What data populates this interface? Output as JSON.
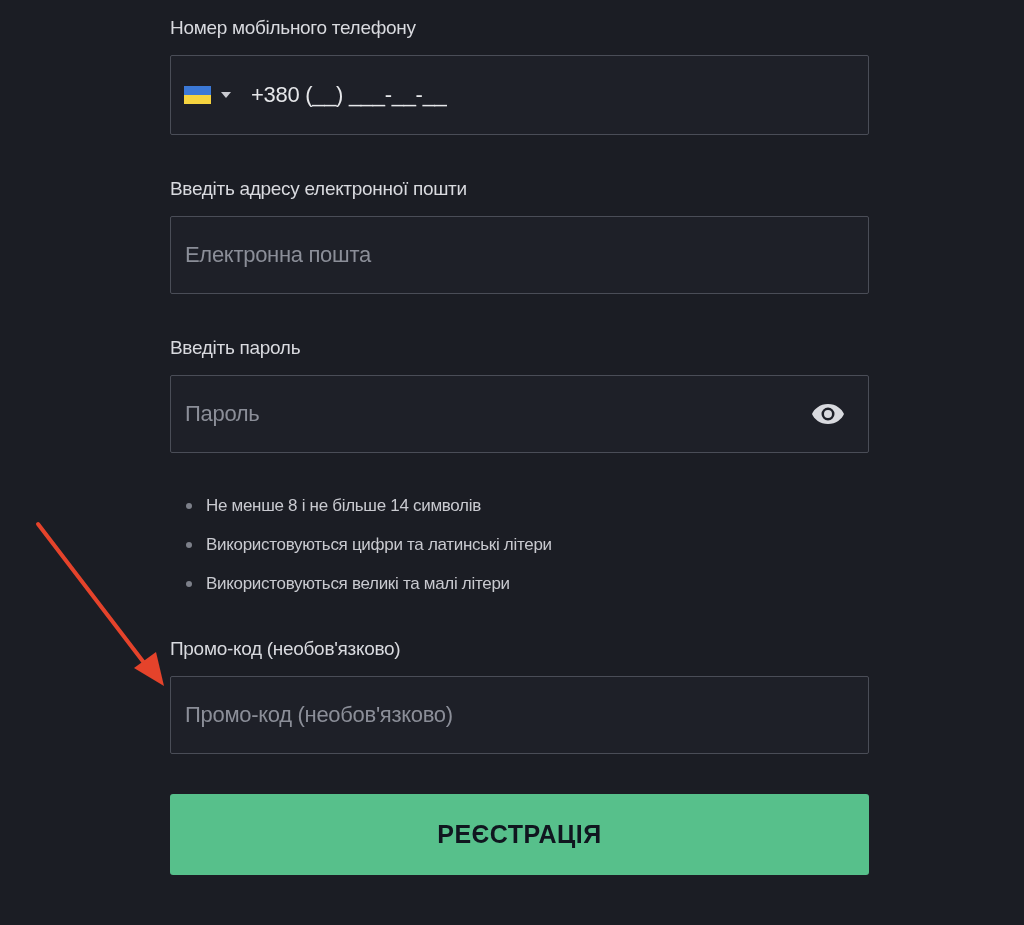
{
  "fields": [
    {
      "kind": "phone",
      "label": "Номер мобільного телефону",
      "value": "+380 (__) ___-__-__"
    },
    {
      "kind": "text",
      "label": "Введіть адресу електронної пошти",
      "placeholder": "Електронна пошта"
    },
    {
      "kind": "password",
      "label": "Введіть пароль",
      "placeholder": "Пароль",
      "rules": [
        "Не менше 8 і не більше 14 символів",
        "Використовуються цифри та латинські літери",
        "Використовуються великі та малі літери"
      ]
    },
    {
      "kind": "text",
      "label": "Промо-код (необов'язково)",
      "placeholder": "Промо-код (необов'язково)"
    }
  ],
  "submit": "РЕЄСТРАЦІЯ"
}
